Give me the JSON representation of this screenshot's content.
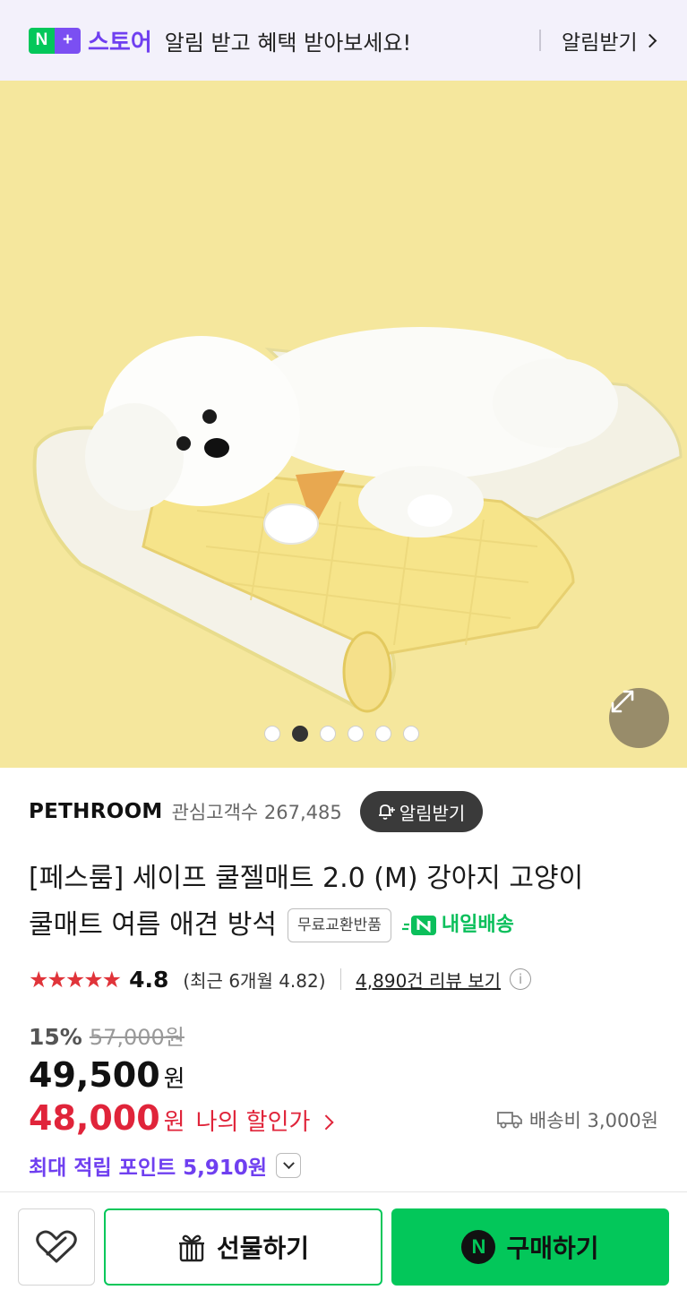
{
  "banner": {
    "logo_n": "N",
    "logo_plus": "+",
    "store": "스토어",
    "message": "알림 받고 혜택 받아보세요!",
    "action": "알림받기"
  },
  "gallery": {
    "image_count": 6,
    "active_index": 1
  },
  "seller": {
    "brand": "PETHROOM",
    "followers_label": "관심고객수 267,485",
    "alert_button": "알림받기"
  },
  "product": {
    "title_line1": "[페스룸] 세이프 쿨젤매트 2.0 (M) 강아지 고양이",
    "title_line2": "쿨매트 여름 애견 방석",
    "tag": "무료교환반품",
    "delivery_badge": "내일배송"
  },
  "rating": {
    "stars": "★★★★★",
    "value": "4.8",
    "recent": "(최근 6개월 4.82)",
    "review_link": "4,890건 리뷰 보기",
    "info": "i"
  },
  "price": {
    "discount_pct": "15%",
    "original": "57,000원",
    "sale": "49,500",
    "sale_unit": "원",
    "my_price": "48,000",
    "my_price_unit": "원",
    "my_price_label": "나의 할인가",
    "shipping": "배송비 3,000원",
    "points": "최대 적립 포인트 5,910원"
  },
  "actions": {
    "gift": "선물하기",
    "buy": "구매하기",
    "buy_badge": "N"
  },
  "colors": {
    "naver_green": "#03c75a",
    "store_purple": "#6f3ff0",
    "price_red": "#e0243a",
    "star_red": "#e0343a",
    "banner_bg": "#f3f1fb",
    "hero_bg": "#f5e79d"
  }
}
